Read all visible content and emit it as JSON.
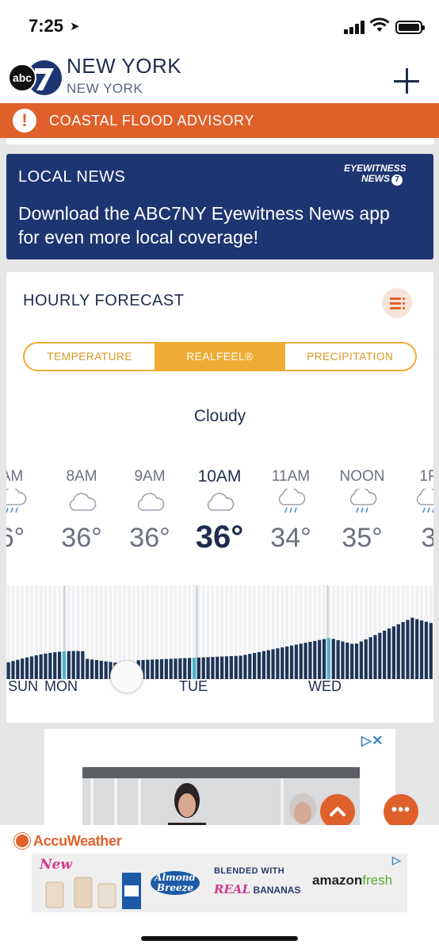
{
  "status_bar": {
    "time": "7:25"
  },
  "header": {
    "city": "NEW YORK",
    "state": "NEW YORK",
    "logo_text": "abc"
  },
  "advisory": {
    "text": "COASTAL FLOOD ADVISORY"
  },
  "news": {
    "title": "LOCAL NEWS",
    "body": "Download the ABC7NY Eyewitness News app for even more local coverage!",
    "logo_line1": "EYEWITNESS",
    "logo_line2": "NEWS"
  },
  "forecast": {
    "title": "HOURLY FORECAST",
    "tabs": [
      {
        "label": "TEMPERATURE",
        "active": false
      },
      {
        "label": "REALFEEL®",
        "active": true
      },
      {
        "label": "PRECIPITATION",
        "active": false
      }
    ],
    "condition": "Cloudy",
    "hours": [
      {
        "label": "AM",
        "temp": "6°",
        "icon": "rain-cloud-icon"
      },
      {
        "label": "8AM",
        "temp": "36°",
        "icon": "cloud-icon"
      },
      {
        "label": "9AM",
        "temp": "36°",
        "icon": "cloud-icon"
      },
      {
        "label": "10AM",
        "temp": "36°",
        "icon": "cloud-icon",
        "current": true
      },
      {
        "label": "11AM",
        "temp": "34°",
        "icon": "rain-cloud-icon"
      },
      {
        "label": "NOON",
        "temp": "35°",
        "icon": "rain-cloud-icon"
      },
      {
        "label": "1P",
        "temp": "3",
        "icon": "rain-cloud-icon"
      }
    ],
    "days": [
      "SUN",
      "MON",
      "TUE",
      "WED"
    ]
  },
  "ad": {
    "choices": "▷✕"
  },
  "bottom": {
    "brand": "AccuWeather",
    "banner": {
      "new": "New",
      "almond": "Almond Breeze",
      "blended": "BLENDED WITH",
      "real": "REAL",
      "bananas": "BANANAS",
      "amazon": "amazon",
      "fresh": "fresh"
    }
  },
  "colors": {
    "accent": "#e0602b",
    "navy": "#1d3570",
    "tab": "#efac34",
    "text": "#1f2d4d"
  }
}
